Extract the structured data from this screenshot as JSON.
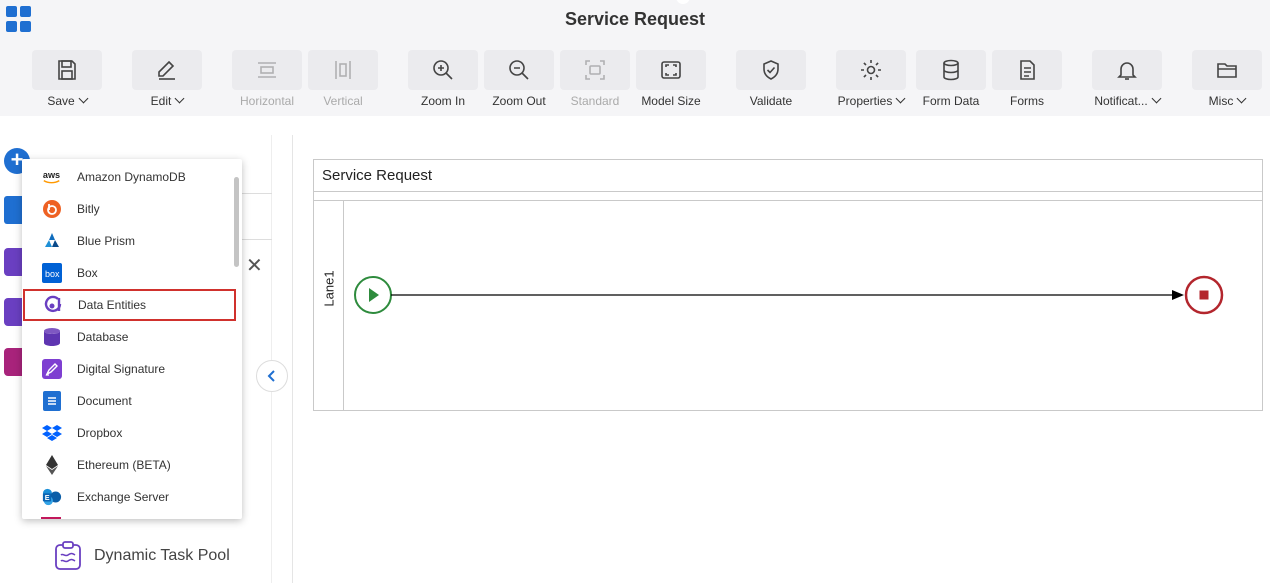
{
  "window": {
    "title": "Service Request"
  },
  "toolbar": {
    "save": "Save",
    "edit": "Edit",
    "horizontal": "Horizontal",
    "vertical": "Vertical",
    "zoom_in": "Zoom In",
    "zoom_out": "Zoom Out",
    "standard": "Standard",
    "model_size": "Model Size",
    "validate": "Validate",
    "properties": "Properties",
    "form_data": "Form Data",
    "forms": "Forms",
    "notifications": "Notificat...",
    "misc": "Misc"
  },
  "dropdown": {
    "items": [
      {
        "label": "Amazon DynamoDB",
        "icon": "aws-icon"
      },
      {
        "label": "Bitly",
        "icon": "bitly-icon"
      },
      {
        "label": "Blue Prism",
        "icon": "blue-prism-icon"
      },
      {
        "label": "Box",
        "icon": "box-icon"
      },
      {
        "label": "Data Entities",
        "icon": "data-entities-icon"
      },
      {
        "label": "Database",
        "icon": "database-icon"
      },
      {
        "label": "Digital Signature",
        "icon": "digital-signature-icon"
      },
      {
        "label": "Document",
        "icon": "document-icon"
      },
      {
        "label": "Dropbox",
        "icon": "dropbox-icon"
      },
      {
        "label": "Ethereum (BETA)",
        "icon": "ethereum-icon"
      },
      {
        "label": "Exchange Server",
        "icon": "exchange-server-icon"
      }
    ],
    "highlighted": "Data Entities",
    "aws_text": "aws",
    "box_text": "box"
  },
  "sidepanel": {
    "dynamic_task_pool": "Dynamic Task Pool"
  },
  "canvas": {
    "pool_title": "Service Request",
    "lane_label": "Lane1"
  },
  "colors": {
    "accent": "#1f6fd1",
    "start_event": "#2e8b3d",
    "end_event": "#b3262d",
    "highlight": "#d0312d"
  }
}
